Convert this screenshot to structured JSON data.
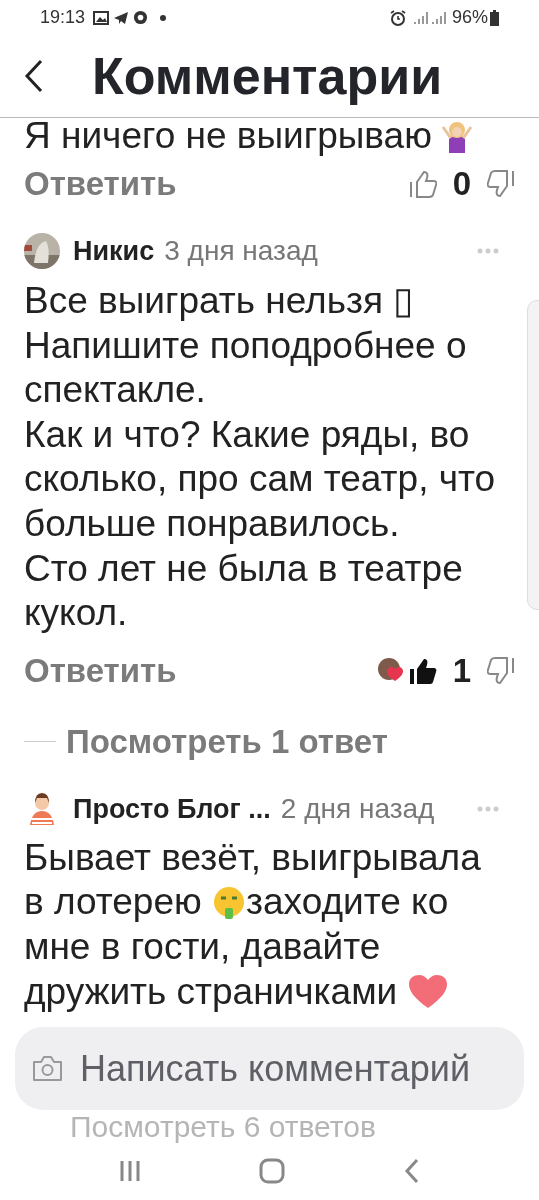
{
  "status_bar": {
    "time": "19:13",
    "battery": "96%"
  },
  "header": {
    "title": "Комментарии"
  },
  "comments": [
    {
      "kind": "partial",
      "text": "Я ничего не выигрываю",
      "reply": "Ответить",
      "likes": "0",
      "liked": false
    },
    {
      "kind": "full",
      "author": "Никис",
      "time": "3 дня назад",
      "text": "Все выиграть нельзя ▯\nНапишите поподробнее о спектакле.\nКак и что? Какие ряды, во сколько, про сам театр, что больше понравилось.\nСто лет не была в театре кукол.",
      "reply": "Ответить",
      "likes": "1",
      "liked": true,
      "replies_link": "Посмотреть 1 ответ"
    },
    {
      "kind": "full",
      "author": "Просто Блог ...",
      "time": "2 дня назад",
      "parts": [
        "Бывает везёт, выигрывала в лотерею ",
        "заходите ко мне в гости, давайте дружить страничками "
      ]
    }
  ],
  "comment_input": {
    "placeholder": "Написать комментарий"
  },
  "faded_link": "Посмотреть 6 ответов"
}
